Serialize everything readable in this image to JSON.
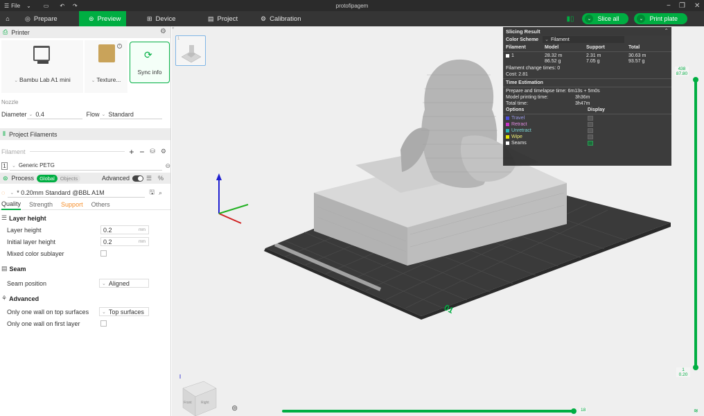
{
  "window": {
    "menu_label": "File",
    "title": "protofipagem"
  },
  "nav": {
    "tabs": [
      {
        "label": "Prepare",
        "icon": "cube-icon"
      },
      {
        "label": "Preview",
        "icon": "layers-icon",
        "active": true
      },
      {
        "label": "Device",
        "icon": "device-icon"
      },
      {
        "label": "Project",
        "icon": "project-icon"
      },
      {
        "label": "Calibration",
        "icon": "calibration-icon"
      }
    ],
    "slice_label": "Slice all",
    "print_label": "Print plate",
    "accent_color": "#00ae42"
  },
  "printer": {
    "section_title": "Printer",
    "printer_name": "Bambu Lab A1 mini",
    "plate_name": "Texture...",
    "sync_label": "Sync info"
  },
  "nozzle": {
    "label": "Nozzle",
    "diameter_label": "Diameter",
    "diameter_value": "0.4",
    "flow_label": "Flow",
    "flow_value": "Standard"
  },
  "filaments": {
    "section_title": "Project Filaments",
    "filament_label": "Filament",
    "items": [
      {
        "index": "1",
        "name": "Generic PETG"
      }
    ]
  },
  "process": {
    "section_title": "Process",
    "global_label": "Global",
    "objects_label": "Objects",
    "advanced_label": "Advanced",
    "preset": "* 0.20mm Standard @BBL A1M",
    "tabs": [
      "Quality",
      "Strength",
      "Support",
      "Others"
    ],
    "groups": {
      "layer_height": {
        "title": "Layer height",
        "layer_height_label": "Layer height",
        "layer_height_value": "0.2",
        "layer_height_unit": "mm",
        "initial_layer_label": "Initial layer height",
        "initial_layer_value": "0.2",
        "initial_layer_unit": "mm",
        "mixed_color_label": "Mixed color sublayer"
      },
      "seam": {
        "title": "Seam",
        "seam_position_label": "Seam position",
        "seam_position_value": "Aligned"
      },
      "advanced": {
        "title": "Advanced",
        "one_wall_top_label": "Only one wall on top surfaces",
        "one_wall_top_value": "Top surfaces",
        "one_wall_first_label": "Only one wall on first layer"
      }
    }
  },
  "slicing_result": {
    "title": "Slicing Result",
    "color_scheme_label": "Color Scheme",
    "color_scheme_value": "Filament",
    "columns": [
      "Filament",
      "Model",
      "Support",
      "Total"
    ],
    "row": {
      "filament": "1",
      "model_len": "28.32 m",
      "model_wt": "86.52 g",
      "support_len": "2.31 m",
      "support_wt": "7.05 g",
      "total_len": "30.63 m",
      "total_wt": "93.57 g"
    },
    "change_times": "Filament change times: 0",
    "cost": "Cost: 2.81",
    "time_title": "Time Estimation",
    "prepare_time": "Prepare and timelapse time: 6m13s + 5m0s",
    "model_print_label": "Model printing time:",
    "model_print_value": "3h36m",
    "total_time_label": "Total time:",
    "total_time_value": "3h47m",
    "options_label": "Options",
    "display_label": "Display",
    "options": [
      {
        "name": "Travel",
        "color": "#4b4bd8",
        "checked": false
      },
      {
        "name": "Retract",
        "color": "#c433c4",
        "checked": false
      },
      {
        "name": "Unretract",
        "color": "#2bb5b5",
        "checked": false
      },
      {
        "name": "Wipe",
        "color": "#e6e600",
        "checked": false
      },
      {
        "name": "Seams",
        "color": "#ffffff",
        "checked": true
      }
    ]
  },
  "layer_slider": {
    "top_layer": "438",
    "top_height": "87.80",
    "bottom_layer": "1",
    "bottom_height": "0.20"
  },
  "move_slider": {
    "value": "18"
  },
  "plate": {
    "thumb_index": "1",
    "plate_number": "01"
  },
  "view_cube": {
    "front_label": "Front",
    "right_label": "Right"
  }
}
